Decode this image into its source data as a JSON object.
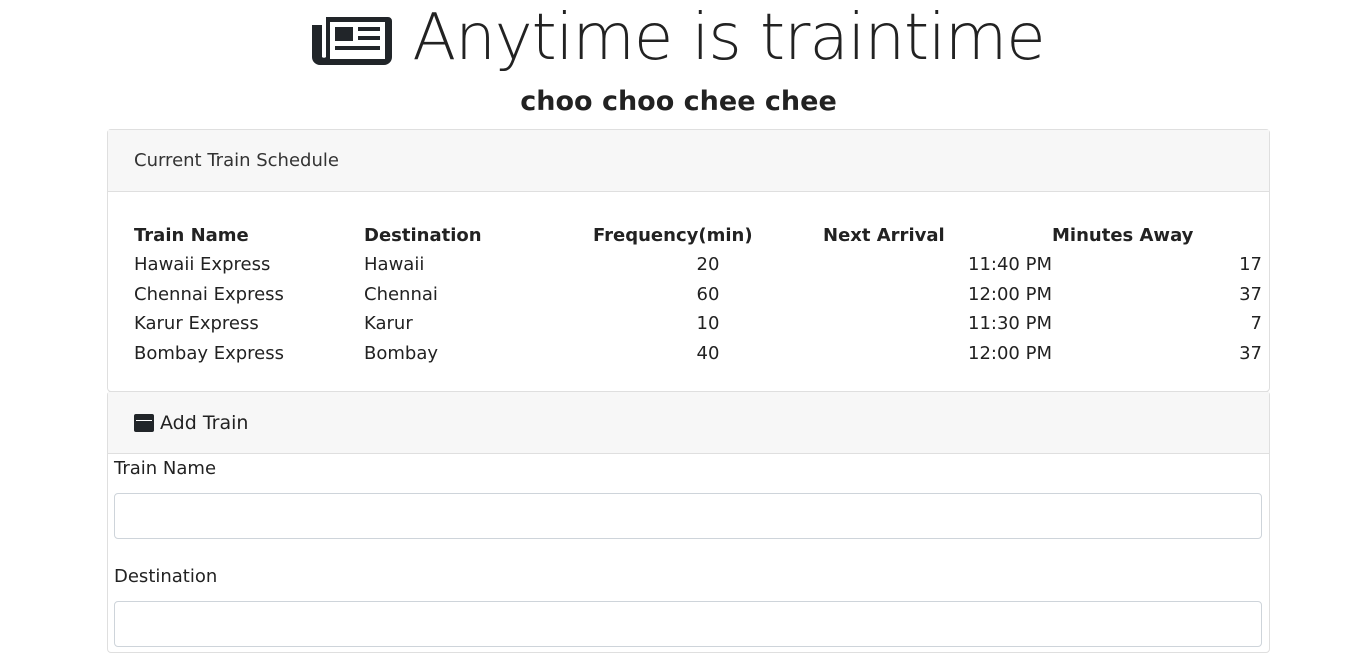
{
  "header": {
    "title": "Anytime is traintime",
    "subtitle": "choo choo chee chee",
    "title_icon": "newspaper-icon"
  },
  "schedule": {
    "heading": "Current Train Schedule",
    "columns": [
      "Train Name",
      "Destination",
      "Frequency(min)",
      "Next Arrival",
      "Minutes Away"
    ],
    "rows": [
      {
        "name": "Hawaii Express",
        "destination": "Hawaii",
        "frequency": "20",
        "next_arrival": "11:40 PM",
        "minutes_away": "17"
      },
      {
        "name": "Chennai Express",
        "destination": "Chennai",
        "frequency": "60",
        "next_arrival": "12:00 PM",
        "minutes_away": "37"
      },
      {
        "name": "Karur Express",
        "destination": "Karur",
        "frequency": "10",
        "next_arrival": "11:30 PM",
        "minutes_away": "7"
      },
      {
        "name": "Bombay Express",
        "destination": "Bombay",
        "frequency": "40",
        "next_arrival": "12:00 PM",
        "minutes_away": "37"
      }
    ]
  },
  "add_train": {
    "heading": "Add Train",
    "heading_icon": "window-icon",
    "fields": [
      {
        "label": "Train Name",
        "value": "",
        "placeholder": ""
      },
      {
        "label": "Destination",
        "value": "",
        "placeholder": ""
      }
    ]
  }
}
